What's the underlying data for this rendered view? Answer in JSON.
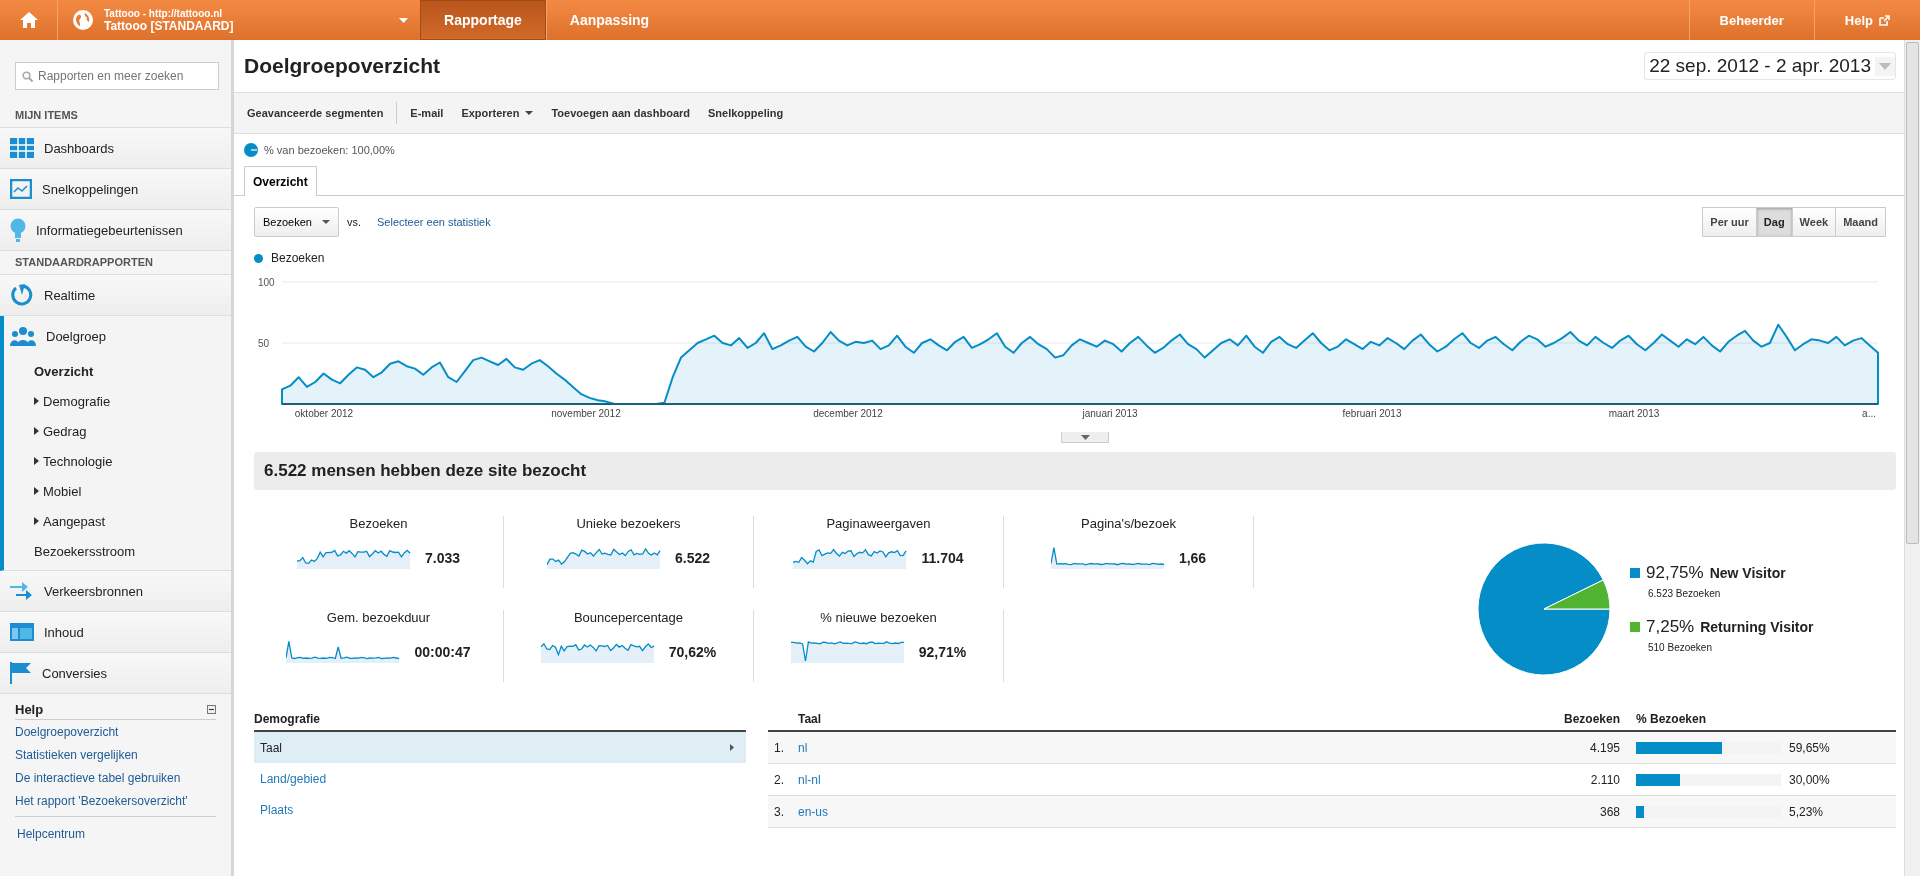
{
  "top_bar": {
    "account": {
      "subtitle": "Tattooo - http://tattooo.nl",
      "title": "Tattooo [STANDAARD]"
    },
    "tabs": [
      {
        "label": "Rapportage",
        "selected": true
      },
      {
        "label": "Aanpassing",
        "selected": false
      }
    ],
    "right_links": [
      {
        "label": "Beheerder",
        "external": false
      },
      {
        "label": "Help",
        "external": true
      }
    ]
  },
  "sidebar": {
    "search": {
      "placeholder": "Rapporten en meer zoeken"
    },
    "sections": [
      {
        "heading": "MIJN ITEMS",
        "items": [
          {
            "label": "Dashboards",
            "selected": false
          },
          {
            "label": "Snelkoppelingen",
            "selected": false
          },
          {
            "label": "Informatiegebeurtenissen",
            "selected": false
          }
        ]
      },
      {
        "heading": "STANDAARDRAPPORTEN",
        "items": [
          {
            "label": "Realtime",
            "selected": false
          },
          {
            "label": "Doelgroep",
            "selected": true,
            "children": [
              {
                "label": "Overzicht",
                "selected": true
              },
              {
                "label": "Demografie",
                "selected": false,
                "expanded": false
              },
              {
                "label": "Gedrag",
                "selected": false,
                "expanded": false
              },
              {
                "label": "Technologie",
                "selected": false,
                "expanded": false
              },
              {
                "label": "Mobiel",
                "selected": false,
                "expanded": false
              },
              {
                "label": "Aangepast",
                "selected": false,
                "expanded": false
              },
              {
                "label": "Bezoekersstroom",
                "selected": false
              }
            ]
          },
          {
            "label": "Verkeersbronnen",
            "selected": false
          },
          {
            "label": "Inhoud",
            "selected": false
          },
          {
            "label": "Conversies",
            "selected": false
          }
        ]
      }
    ],
    "help": {
      "title": "Help",
      "links": [
        "Doelgroepoverzicht",
        "Statistieken vergelijken",
        "De interactieve tabel gebruiken",
        "Het rapport 'Bezoekersoverzicht'"
      ],
      "footer_link": "Helpcentrum"
    }
  },
  "main": {
    "title": "Doelgroepoverzicht",
    "date_range": "22 sep. 2012 - 2 apr. 2013",
    "toolbar": [
      {
        "label": "Geavanceerde segmenten",
        "dropdown": false
      },
      {
        "label": "E-mail",
        "dropdown": false
      },
      {
        "label": "Exporteren",
        "dropdown": true
      },
      {
        "label": "Toevoegen aan dashboard",
        "dropdown": false
      },
      {
        "label": "Snelkoppeling",
        "dropdown": false
      }
    ],
    "segment": "% van bezoeken: 100,00%",
    "tabs": [
      {
        "label": "Overzicht",
        "selected": true
      }
    ],
    "metric_select": {
      "value": "Bezoeken"
    },
    "vs_label": "vs.",
    "compare_link": "Selecteer een statistiek",
    "granularity": [
      {
        "label": "Per uur",
        "selected": false
      },
      {
        "label": "Dag",
        "selected": true
      },
      {
        "label": "Week",
        "selected": false
      },
      {
        "label": "Maand",
        "selected": false
      }
    ],
    "chart": {
      "month_labels": [
        "oktober 2012",
        "november 2012",
        "december 2012",
        "januari 2013",
        "februari 2013",
        "maart 2013",
        "a..."
      ],
      "chart_data": {
        "type": "area",
        "ylim": [
          0,
          100
        ],
        "yticks": [
          50,
          100
        ],
        "series": [
          {
            "name": "Bezoeken",
            "color": "#058dc7",
            "values": [
              12,
              15,
              22,
              14,
              18,
              25,
              20,
              17,
              24,
              30,
              28,
              22,
              26,
              33,
              35,
              31,
              29,
              24,
              30,
              34,
              22,
              18,
              27,
              36,
              38,
              35,
              32,
              37,
              30,
              28,
              33,
              36,
              31,
              25,
              20,
              14,
              8,
              5,
              3,
              2,
              0,
              0,
              0,
              0,
              0,
              0,
              1,
              22,
              38,
              44,
              50,
              53,
              56,
              50,
              48,
              54,
              46,
              50,
              58,
              45,
              48,
              52,
              55,
              47,
              43,
              50,
              59,
              52,
              48,
              51,
              50,
              52,
              45,
              48,
              56,
              47,
              42,
              50,
              53,
              48,
              44,
              51,
              55,
              46,
              49,
              53,
              58,
              47,
              42,
              50,
              55,
              49,
              45,
              38,
              40,
              48,
              53,
              50,
              47,
              52,
              49,
              43,
              50,
              55,
              48,
              42,
              46,
              52,
              57,
              49,
              45,
              38,
              44,
              50,
              53,
              48,
              56,
              47,
              42,
              51,
              55,
              49,
              46,
              52,
              58,
              50,
              44,
              47,
              53,
              49,
              45,
              51,
              48,
              54,
              50,
              45,
              52,
              57,
              49,
              43,
              47,
              53,
              58,
              50,
              46,
              52,
              55,
              49,
              44,
              51,
              56,
              53,
              47,
              50,
              54,
              59,
              52,
              48,
              55,
              50,
              46,
              52,
              56,
              49,
              44,
              50,
              57,
              52,
              47,
              53,
              49,
              55,
              48,
              43,
              51,
              56,
              60,
              52,
              47,
              50,
              65,
              55,
              44,
              49,
              53,
              52,
              50,
              55,
              48,
              52,
              54,
              48,
              42
            ]
          }
        ]
      }
    },
    "summary_title": "6.522 mensen hebben deze site bezocht",
    "metrics": [
      {
        "label": "Bezoeken",
        "value": "7.033"
      },
      {
        "label": "Unieke bezoekers",
        "value": "6.522"
      },
      {
        "label": "Paginaweergaven",
        "value": "11.704"
      },
      {
        "label": "Pagina's/bezoek",
        "value": "1,66"
      },
      {
        "label": "Gem. bezoekduur",
        "value": "00:00:47"
      },
      {
        "label": "Bouncepercentage",
        "value": "70,62%"
      },
      {
        "label": "% nieuwe bezoeken",
        "value": "92,71%"
      }
    ],
    "visitor_pie": {
      "chart_data": {
        "type": "pie",
        "categories": [
          "New Visitor",
          "Returning Visitor"
        ],
        "series": [
          {
            "values": [
              92.75,
              7.25
            ]
          }
        ],
        "colors": [
          "#058dc7",
          "#50b432"
        ]
      },
      "legend": [
        {
          "percent": "92,75%",
          "count": "6.523 Bezoeken"
        },
        {
          "percent": "7,25%",
          "count": "510 Bezoeken"
        }
      ]
    },
    "demographics": {
      "heading": "Demografie",
      "items": [
        {
          "label": "Taal",
          "selected": true
        },
        {
          "label": "Land/gebied",
          "selected": false
        },
        {
          "label": "Plaats",
          "selected": false
        }
      ]
    },
    "language_table": {
      "columns": [
        "Taal",
        "Bezoeken",
        "% Bezoeken"
      ],
      "rows": [
        {
          "rank": "1.",
          "label": "nl",
          "visits": "4.195",
          "share": "59,65%",
          "level": 0.5965
        },
        {
          "rank": "2.",
          "label": "nl-nl",
          "visits": "2.110",
          "share": "30,00%",
          "level": 0.3
        },
        {
          "rank": "3.",
          "label": "en-us",
          "visits": "368",
          "share": "5,23%",
          "level": 0.0523
        }
      ]
    }
  }
}
